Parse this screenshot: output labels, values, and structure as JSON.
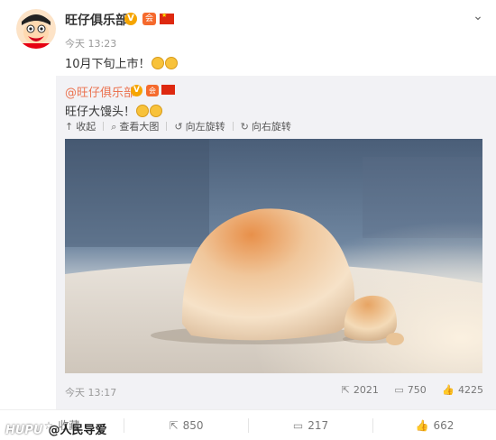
{
  "post": {
    "author": "旺仔俱乐部",
    "time": "今天 13:23",
    "text": "10月下旬上市！",
    "verified_glyph": "V",
    "vip_glyph": "会"
  },
  "repost": {
    "author": "@旺仔俱乐部",
    "text": "旺仔大馒头！",
    "toolbar": {
      "collapse": "收起",
      "view_large": "查看大图",
      "rotate_left": "向左旋转",
      "rotate_right": "向右旋转"
    },
    "time": "今天 13:17",
    "stats": {
      "reposts": "2021",
      "comments": "750",
      "likes": "4225"
    }
  },
  "footer": {
    "favorite": "收藏",
    "reposts": "850",
    "comments": "217",
    "likes": "662"
  },
  "watermark": {
    "brand": "HUPU",
    "text": "@人民导爱"
  },
  "colors": {
    "accent": "#eb7350",
    "verified": "#f6a500",
    "flag": "#de2910"
  },
  "icons": {
    "chevron": "chevron-down-icon",
    "collapse": "arrow-up-icon",
    "view_large": "magnifier-icon",
    "rotate_left": "rotate-left-icon",
    "rotate_right": "rotate-right-icon",
    "repost": "share-icon",
    "comment": "comment-icon",
    "like": "thumbs-up-icon"
  }
}
